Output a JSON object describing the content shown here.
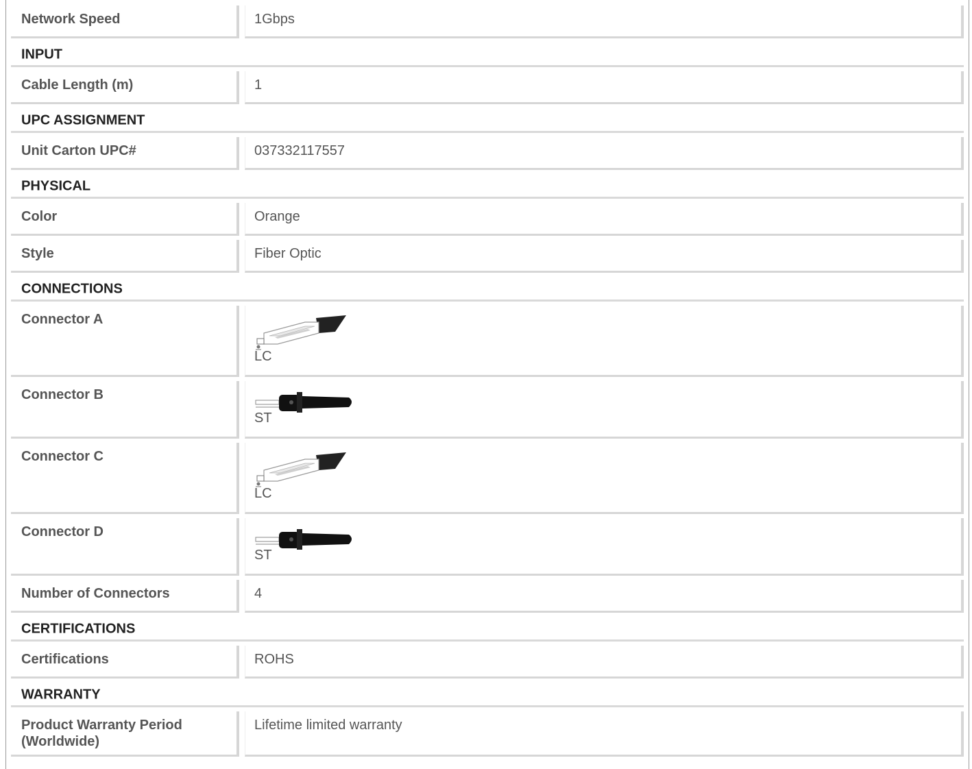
{
  "rows": [
    {
      "kind": "data",
      "key": "network_speed",
      "label": "Network Speed",
      "value": "1Gbps"
    },
    {
      "kind": "section",
      "label": "INPUT"
    },
    {
      "kind": "data",
      "key": "cable_length",
      "label": "Cable Length (m)",
      "value": "1"
    },
    {
      "kind": "section",
      "label": "UPC ASSIGNMENT"
    },
    {
      "kind": "data",
      "key": "unit_carton_upc",
      "label": "Unit Carton UPC#",
      "value": "037332117557"
    },
    {
      "kind": "section",
      "label": "PHYSICAL"
    },
    {
      "kind": "data",
      "key": "color",
      "label": "Color",
      "value": "Orange"
    },
    {
      "kind": "data",
      "key": "style",
      "label": "Style",
      "value": "Fiber Optic"
    },
    {
      "kind": "section",
      "label": "CONNECTIONS"
    },
    {
      "kind": "connector",
      "key": "connector_a",
      "label": "Connector A",
      "value": "LC",
      "icon": "lc-connector-icon"
    },
    {
      "kind": "connector",
      "key": "connector_b",
      "label": "Connector B",
      "value": "ST",
      "icon": "st-connector-icon"
    },
    {
      "kind": "connector",
      "key": "connector_c",
      "label": "Connector C",
      "value": "LC",
      "icon": "lc-connector-icon"
    },
    {
      "kind": "connector",
      "key": "connector_d",
      "label": "Connector D",
      "value": "ST",
      "icon": "st-connector-icon"
    },
    {
      "kind": "data",
      "key": "number_of_connectors",
      "label": "Number of Connectors",
      "value": "4"
    },
    {
      "kind": "section",
      "label": "CERTIFICATIONS"
    },
    {
      "kind": "data",
      "key": "certifications",
      "label": "Certifications",
      "value": "ROHS"
    },
    {
      "kind": "section",
      "label": "WARRANTY"
    },
    {
      "kind": "data",
      "key": "warranty",
      "label": "Product Warranty Period (Worldwide)",
      "value": "Lifetime limited warranty"
    }
  ]
}
